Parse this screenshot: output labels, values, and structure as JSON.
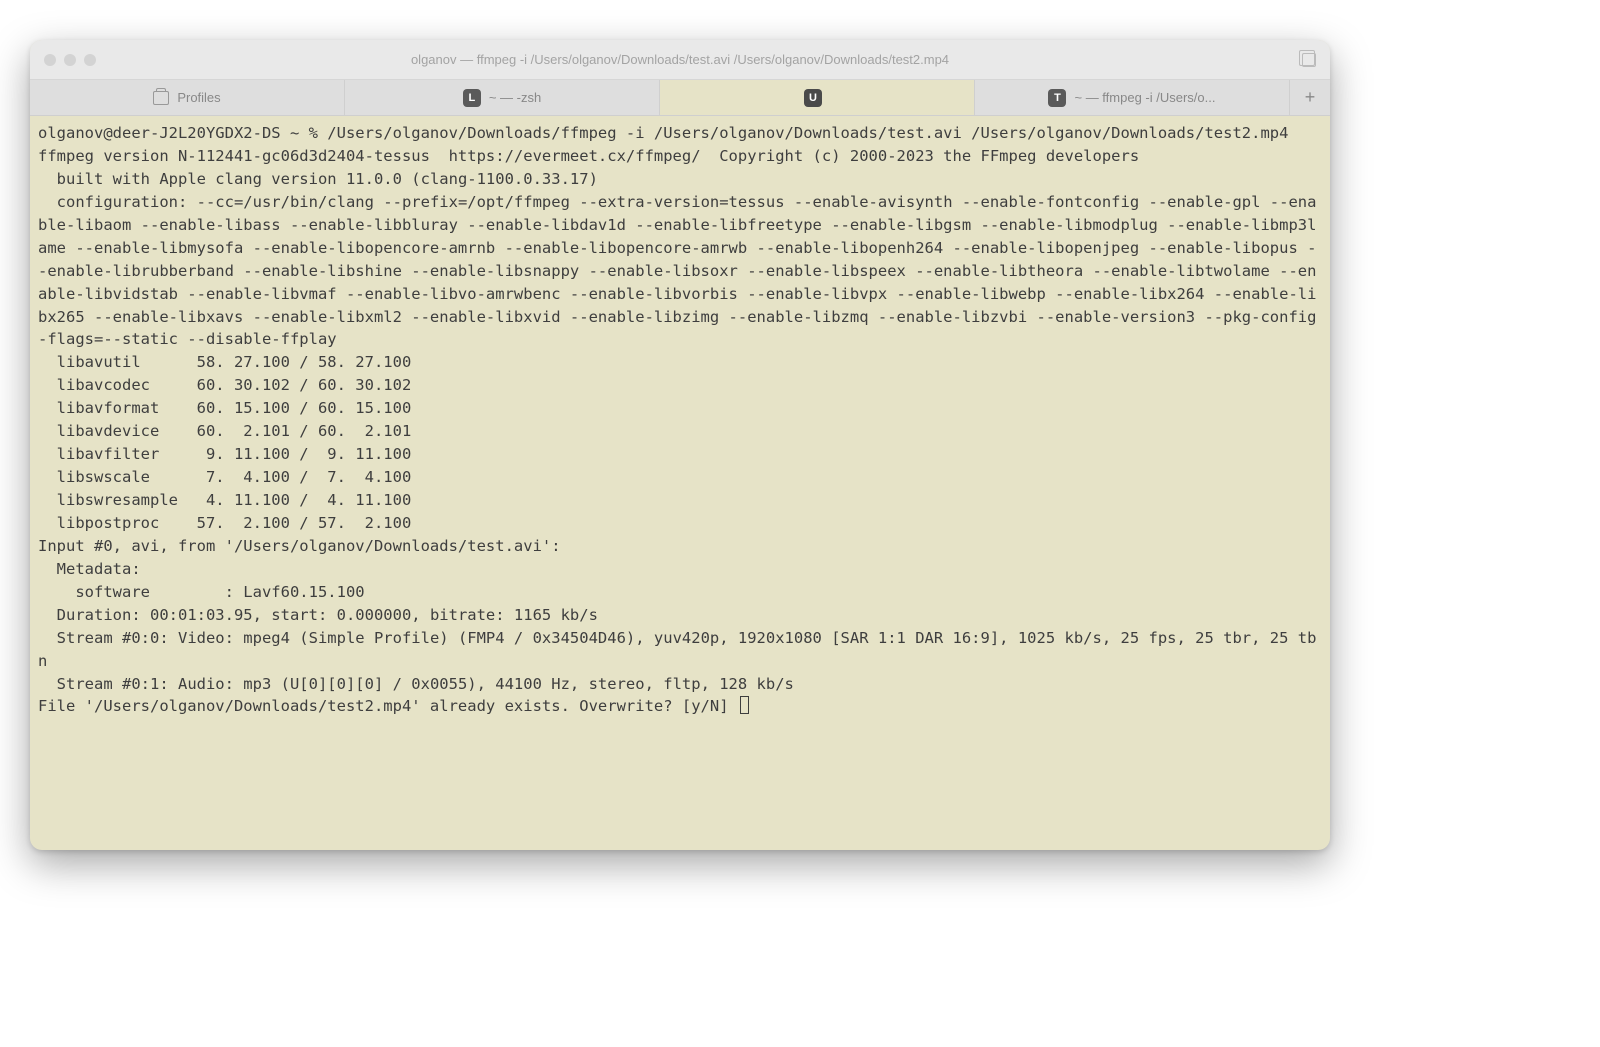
{
  "window": {
    "title": "olganov — ffmpeg -i /Users/olganov/Downloads/test.avi /Users/olganov/Downloads/test2.mp4"
  },
  "tabs": {
    "profiles_label": "Profiles",
    "items": [
      {
        "badge": "L",
        "label": "~ — -zsh"
      },
      {
        "badge": "U",
        "label": ""
      },
      {
        "badge": "T",
        "label": "~ — ffmpeg -i /Users/o..."
      }
    ],
    "active_index": 1
  },
  "terminal": {
    "prompt": "olganov@deer-J2L20YGDX2-DS ~ % /Users/olganov/Downloads/ffmpeg -i /Users/olganov/Downloads/test.avi /Users/olganov/Downloads/test2.mp4",
    "version_line": "ffmpeg version N-112441-gc06d3d2404-tessus  https://evermeet.cx/ffmpeg/  Copyright (c) 2000-2023 the FFmpeg developers",
    "built_line": "  built with Apple clang version 11.0.0 (clang-1100.0.33.17)",
    "config_line": "  configuration: --cc=/usr/bin/clang --prefix=/opt/ffmpeg --extra-version=tessus --enable-avisynth --enable-fontconfig --enable-gpl --enable-libaom --enable-libass --enable-libbluray --enable-libdav1d --enable-libfreetype --enable-libgsm --enable-libmodplug --enable-libmp3lame --enable-libmysofa --enable-libopencore-amrnb --enable-libopencore-amrwb --enable-libopenh264 --enable-libopenjpeg --enable-libopus --enable-librubberband --enable-libshine --enable-libsnappy --enable-libsoxr --enable-libspeex --enable-libtheora --enable-libtwolame --enable-libvidstab --enable-libvmaf --enable-libvo-amrwbenc --enable-libvorbis --enable-libvpx --enable-libwebp --enable-libx264 --enable-libx265 --enable-libxavs --enable-libxml2 --enable-libxvid --enable-libzimg --enable-libzmq --enable-libzvbi --enable-version3 --pkg-config-flags=--static --disable-ffplay",
    "libs": [
      "  libavutil      58. 27.100 / 58. 27.100",
      "  libavcodec     60. 30.102 / 60. 30.102",
      "  libavformat    60. 15.100 / 60. 15.100",
      "  libavdevice    60.  2.101 / 60.  2.101",
      "  libavfilter     9. 11.100 /  9. 11.100",
      "  libswscale      7.  4.100 /  7.  4.100",
      "  libswresample   4. 11.100 /  4. 11.100",
      "  libpostproc    57.  2.100 / 57.  2.100"
    ],
    "input_header": "Input #0, avi, from '/Users/olganov/Downloads/test.avi':",
    "metadata_label": "  Metadata:",
    "metadata_software": "    software        : Lavf60.15.100",
    "duration_line": "  Duration: 00:01:03.95, start: 0.000000, bitrate: 1165 kb/s",
    "stream_video": "  Stream #0:0: Video: mpeg4 (Simple Profile) (FMP4 / 0x34504D46), yuv420p, 1920x1080 [SAR 1:1 DAR 16:9], 1025 kb/s, 25 fps, 25 tbr, 25 tbn",
    "stream_audio": "  Stream #0:1: Audio: mp3 (U[0][0][0] / 0x0055), 44100 Hz, stereo, fltp, 128 kb/s",
    "overwrite_prompt": "File '/Users/olganov/Downloads/test2.mp4' already exists. Overwrite? [y/N] "
  }
}
